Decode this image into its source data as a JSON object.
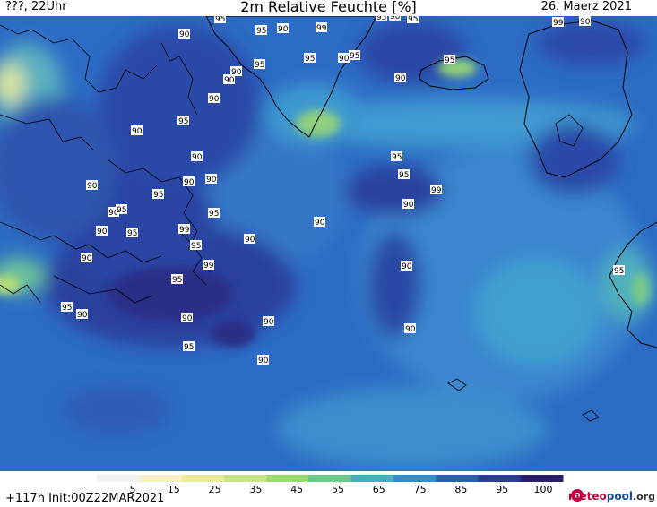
{
  "header": {
    "left": "???, 22Uhr",
    "title": "2m Relative Feuchte [%]",
    "right": "26. Maerz 2021"
  },
  "footer": {
    "init": "+117h  Init:00Z22MAR2021",
    "brand_part1": "meteo",
    "brand_part2": "pool",
    "brand_part3": ".org"
  },
  "legend": {
    "ticks": [
      "5",
      "15",
      "25",
      "35",
      "45",
      "55",
      "65",
      "75",
      "85",
      "95",
      "100"
    ],
    "colors": [
      "#f2f2f2",
      "#f5f2c8",
      "#e9ed9c",
      "#c9e486",
      "#9cd96f",
      "#69c889",
      "#3fb3b8",
      "#2f8fd0",
      "#2a5fb8",
      "#2a3c99",
      "#2b1f6e"
    ]
  },
  "contour_labels": [
    {
      "text": "95"
    },
    {
      "text": "99"
    },
    {
      "text": "90"
    },
    {
      "text": "95"
    },
    {
      "text": "90"
    },
    {
      "text": "95"
    },
    {
      "text": "90"
    },
    {
      "text": "95"
    },
    {
      "text": "99"
    },
    {
      "text": "90"
    },
    {
      "text": "95"
    },
    {
      "text": "90"
    },
    {
      "text": "90"
    },
    {
      "text": "95"
    },
    {
      "text": "90"
    },
    {
      "text": "95"
    },
    {
      "text": "95"
    },
    {
      "text": "90"
    },
    {
      "text": "90"
    },
    {
      "text": "95"
    },
    {
      "text": "90"
    },
    {
      "text": "90"
    },
    {
      "text": "90"
    },
    {
      "text": "90"
    },
    {
      "text": "95"
    },
    {
      "text": "95"
    },
    {
      "text": "99"
    },
    {
      "text": "90"
    },
    {
      "text": "90"
    },
    {
      "text": "95"
    },
    {
      "text": "90"
    },
    {
      "text": "90"
    },
    {
      "text": "95"
    },
    {
      "text": "90"
    },
    {
      "text": "95"
    },
    {
      "text": "99"
    },
    {
      "text": "95"
    },
    {
      "text": "90"
    },
    {
      "text": "95"
    },
    {
      "text": "90"
    },
    {
      "text": "99"
    },
    {
      "text": "95"
    },
    {
      "text": "90"
    },
    {
      "text": "95"
    },
    {
      "text": "95"
    },
    {
      "text": "90"
    },
    {
      "text": "90"
    },
    {
      "text": "90"
    },
    {
      "text": "90"
    },
    {
      "text": "95"
    },
    {
      "text": "90"
    }
  ]
}
